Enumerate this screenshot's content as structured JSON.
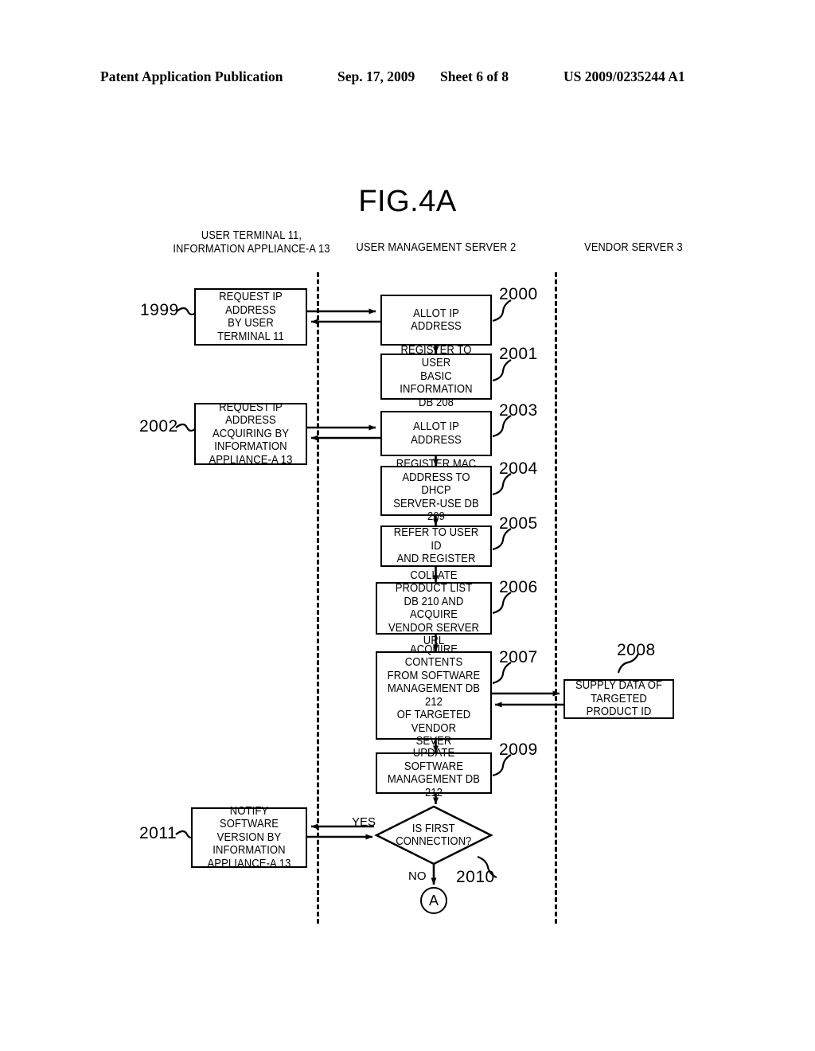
{
  "page_header": {
    "left": "Patent Application Publication",
    "date": "Sep. 17, 2009",
    "sheet": "Sheet 6 of 8",
    "doc_number": "US 2009/0235244 A1"
  },
  "figure": {
    "title": "FIG.4A"
  },
  "lanes": [
    {
      "id": "lane-user-terminal",
      "label": "USER TERMINAL 11,\nINFORMATION APPLIANCE-A 13"
    },
    {
      "id": "lane-user-management-server",
      "label": "USER MANAGEMENT SERVER 2"
    },
    {
      "id": "lane-vendor-server",
      "label": "VENDOR SERVER 3"
    }
  ],
  "nodes": [
    {
      "id": "node-1999",
      "step": "1999",
      "lane": 0,
      "shape": "process",
      "label": "REQUEST IP ADDRESS\nBY USER TERMINAL 11"
    },
    {
      "id": "node-2000",
      "step": "2000",
      "lane": 1,
      "shape": "process",
      "label": "ALLOT IP ADDRESS"
    },
    {
      "id": "node-2001",
      "step": "2001",
      "lane": 1,
      "shape": "process",
      "label": "REGISTER TO USER\nBASIC INFORMATION\nDB 208"
    },
    {
      "id": "node-2002",
      "step": "2002",
      "lane": 0,
      "shape": "process",
      "label": "REQUEST IP ADDRESS\nACQUIRING BY\nINFORMATION\nAPPLIANCE-A 13"
    },
    {
      "id": "node-2003",
      "step": "2003",
      "lane": 1,
      "shape": "process",
      "label": "ALLOT IP ADDRESS"
    },
    {
      "id": "node-2004",
      "step": "2004",
      "lane": 1,
      "shape": "process",
      "label": "REGISTER MAC\nADDRESS TO DHCP\nSERVER-USE DB 209"
    },
    {
      "id": "node-2005",
      "step": "2005",
      "lane": 1,
      "shape": "process",
      "label": "REFER TO USER ID\nAND REGISTER"
    },
    {
      "id": "node-2006",
      "step": "2006",
      "lane": 1,
      "shape": "process",
      "label": "COLLATE PRODUCT LIST\nDB 210 AND ACQUIRE\nVENDOR SERVER URL"
    },
    {
      "id": "node-2007",
      "step": "2007",
      "lane": 1,
      "shape": "process",
      "label": "ACQUIRE CONTENTS\nFROM SOFTWARE\nMANAGEMENT DB 212\nOF TARGETED VENDOR\nSEVER"
    },
    {
      "id": "node-2008",
      "step": "2008",
      "lane": 2,
      "shape": "process",
      "label": "SUPPLY DATA OF\nTARGETED PRODUCT ID"
    },
    {
      "id": "node-2009",
      "step": "2009",
      "lane": 1,
      "shape": "process",
      "label": "UPDATE SOFTWARE\nMANAGEMENT DB 212"
    },
    {
      "id": "node-2010",
      "step": "2010",
      "lane": 1,
      "shape": "decision",
      "label": "IS FIRST\nCONNECTION?"
    },
    {
      "id": "node-2011",
      "step": "2011",
      "lane": 0,
      "shape": "process",
      "label": "NOTIFY SOFTWARE\nVERSION BY\nINFORMATION\nAPPLIANCE-A 13"
    }
  ],
  "edge_labels": {
    "yes": "YES",
    "no": "NO"
  },
  "connector": {
    "id": "connector-a",
    "label": "A"
  },
  "colors": {
    "ink": "#000000",
    "paper": "#ffffff"
  }
}
